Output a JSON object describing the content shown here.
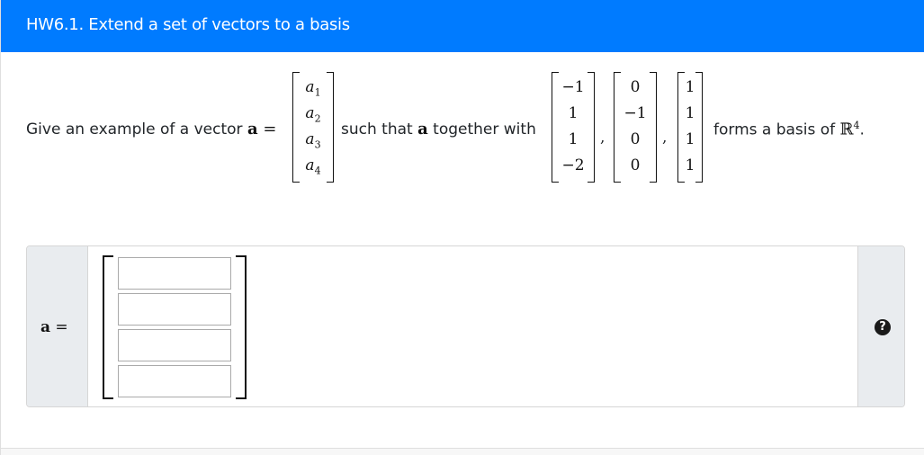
{
  "header": {
    "title": "HW6.1. Extend a set of vectors to a basis"
  },
  "question": {
    "prefix": "Give an example of a vector ",
    "vector_symbol": "a",
    "equals": " =",
    "vector_entries": [
      "a1",
      "a2",
      "a3",
      "a4"
    ],
    "middle_text_1": "such that ",
    "middle_bold": "a",
    "middle_text_2": " together with",
    "given_vectors": [
      [
        "−1",
        "1",
        "1",
        "−2"
      ],
      [
        "0",
        "−1",
        "0",
        "0"
      ],
      [
        "1",
        "1",
        "1",
        "1"
      ]
    ],
    "separator": ",",
    "suffix": "forms a basis of ",
    "space": "ℝ",
    "space_exp": "4",
    "suffix_end": "."
  },
  "answer": {
    "label": "a",
    "label_eq": " =",
    "inputs": [
      {
        "value": "",
        "placeholder": ""
      },
      {
        "value": "",
        "placeholder": ""
      },
      {
        "value": "",
        "placeholder": ""
      },
      {
        "value": "",
        "placeholder": ""
      }
    ],
    "help_icon": "question-circle-icon",
    "help_glyph": "?"
  },
  "colors": {
    "header_bg": "#007bff",
    "label_bg": "#e9ecef"
  }
}
